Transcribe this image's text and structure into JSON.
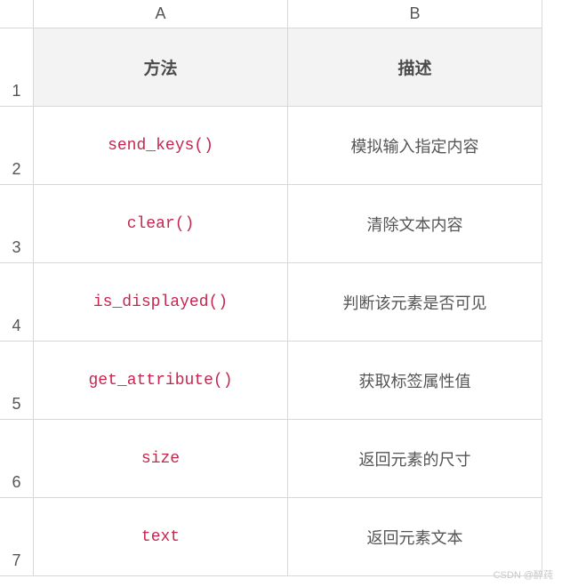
{
  "columns": [
    "A",
    "B"
  ],
  "row_numbers": [
    "1",
    "2",
    "3",
    "4",
    "5",
    "6",
    "7"
  ],
  "headers": {
    "method": "方法",
    "description": "描述"
  },
  "rows": [
    {
      "method": "send_keys()",
      "description": "模拟输入指定内容"
    },
    {
      "method": "clear()",
      "description": "清除文本内容"
    },
    {
      "method": "is_displayed()",
      "description": "判断该元素是否可见"
    },
    {
      "method": "get_attribute()",
      "description": "获取标签属性值"
    },
    {
      "method": "size",
      "description": "返回元素的尺寸"
    },
    {
      "method": "text",
      "description": "返回元素文本"
    }
  ],
  "watermark": "CSDN @醉莼"
}
